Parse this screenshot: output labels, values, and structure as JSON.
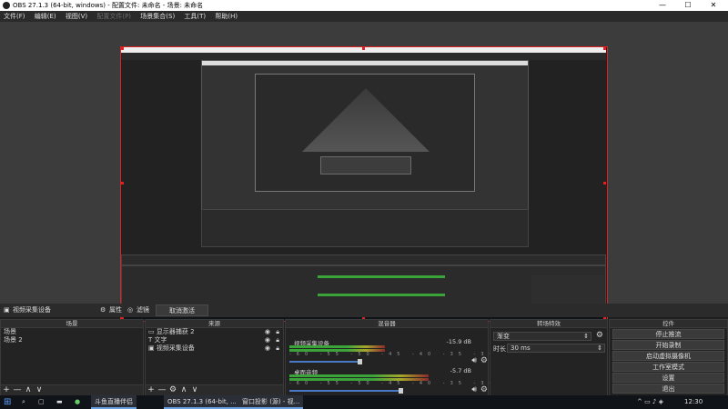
{
  "window": {
    "title": "OBS 27.1.3 (64-bit, windows) - 配置文件: 未命名 - 场景: 未命名",
    "controls": {
      "minimize": "—",
      "maximize": "☐",
      "close": "✕"
    }
  },
  "menu": [
    {
      "label": "文件(F)",
      "disabled": false
    },
    {
      "label": "编辑(E)",
      "disabled": false
    },
    {
      "label": "视图(V)",
      "disabled": false
    },
    {
      "label": "配置文件(P)",
      "disabled": true
    },
    {
      "label": "场景集合(S)",
      "disabled": false
    },
    {
      "label": "工具(T)",
      "disabled": false
    },
    {
      "label": "帮助(H)",
      "disabled": false
    }
  ],
  "source_toolbar": {
    "selected_source": "视频采集设备",
    "properties_label": "属性",
    "filters_label": "滤镜",
    "deactivate_label": "取消激活"
  },
  "scenes": {
    "header": "场景",
    "items": [
      "场景",
      "场景 2"
    ]
  },
  "sources": {
    "header": "来源",
    "items": [
      "显示器捕获 2",
      "文字",
      "视频采集设备"
    ]
  },
  "mixer": {
    "header": "混音器",
    "channels": [
      {
        "name": "视频采集设备",
        "db": "-15.9 dB",
        "level": 0.62,
        "volume": 0.45
      },
      {
        "name": "桌面音频",
        "db": "-5.7 dB",
        "level": 0.9,
        "volume": 0.72
      }
    ],
    "tick_labels": [
      "-60",
      "-55",
      "-50",
      "-45",
      "-40",
      "-35",
      "-30",
      "-25",
      "-20",
      "-15",
      "-10",
      "-5",
      "0"
    ]
  },
  "transitions": {
    "header": "转场特效",
    "selected": "渐变",
    "duration_label": "时长",
    "duration_value": "30 ms"
  },
  "controls": {
    "header": "控件",
    "buttons": [
      "停止推流",
      "开始录制",
      "启动虚拟摄像机",
      "工作室模式",
      "设置",
      "退出"
    ]
  },
  "taskbar": {
    "apps": [
      "斗鱼直播伴侣",
      "OBS 27.1.3 (64-bit, ...",
      "窗口投影 (源) - 视..."
    ],
    "time": "12:30"
  },
  "footer_icons": {
    "add": "+",
    "remove": "—",
    "up": "∧",
    "down": "∨",
    "config": "⚙"
  }
}
